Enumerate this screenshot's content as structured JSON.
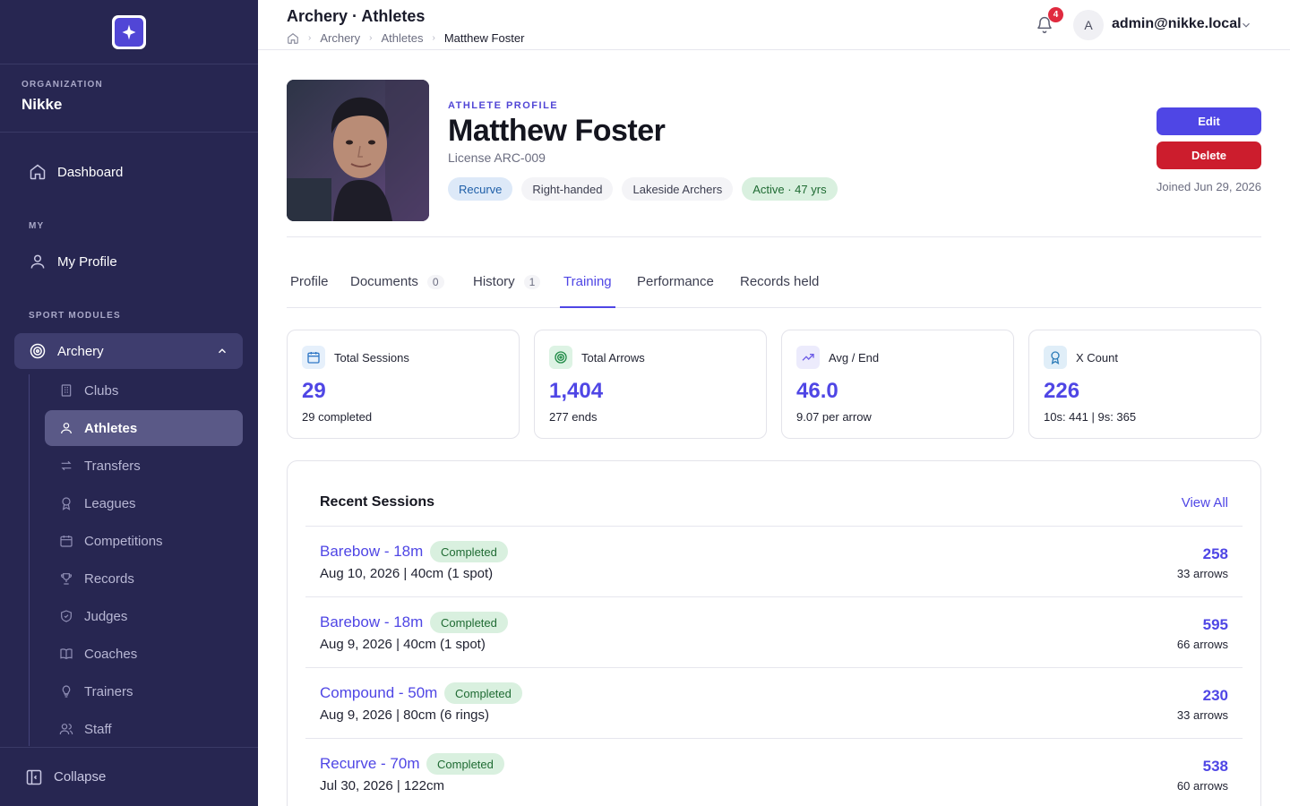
{
  "sidebar": {
    "org_label": "ORGANIZATION",
    "org_name": "Nikke",
    "dashboard": "Dashboard",
    "my_label": "MY",
    "my_profile": "My Profile",
    "modules_label": "SPORT MODULES",
    "module": "Archery",
    "sub_items": [
      {
        "label": "Clubs",
        "icon": "building-icon"
      },
      {
        "label": "Athletes",
        "icon": "user-icon"
      },
      {
        "label": "Transfers",
        "icon": "arrows-icon"
      },
      {
        "label": "Leagues",
        "icon": "award-icon"
      },
      {
        "label": "Competitions",
        "icon": "calendar-icon"
      },
      {
        "label": "Records",
        "icon": "trophy-icon"
      },
      {
        "label": "Judges",
        "icon": "shield-icon"
      },
      {
        "label": "Coaches",
        "icon": "book-icon"
      },
      {
        "label": "Trainers",
        "icon": "lightbulb-icon"
      },
      {
        "label": "Staff",
        "icon": "users-icon"
      }
    ],
    "active_item": "Athletes",
    "collapse": "Collapse"
  },
  "header": {
    "title": "Archery · Athletes",
    "breadcrumbs": [
      "Archery",
      "Athletes",
      "Matthew Foster"
    ],
    "notification_count": "4",
    "avatar_initial": "A",
    "user_email": "admin@nikke.local"
  },
  "profile": {
    "eyebrow": "ATHLETE PROFILE",
    "name": "Matthew Foster",
    "license": "License ARC-009",
    "tags": [
      "Recurve",
      "Right-handed",
      "Lakeside Archers",
      "Active · 47 yrs"
    ],
    "edit_label": "Edit",
    "delete_label": "Delete",
    "joined": "Joined Jun 29, 2026"
  },
  "tabs": [
    {
      "label": "Profile"
    },
    {
      "label": "Documents",
      "count": "0"
    },
    {
      "label": "History",
      "count": "1"
    },
    {
      "label": "Training"
    },
    {
      "label": "Performance"
    },
    {
      "label": "Records held"
    }
  ],
  "active_tab": "Training",
  "stats": [
    {
      "label": "Total Sessions",
      "value": "29",
      "sub": "29 completed",
      "icon": "calendar-icon"
    },
    {
      "label": "Total Arrows",
      "value": "1,404",
      "sub": "277 ends",
      "icon": "target-icon"
    },
    {
      "label": "Avg / End",
      "value": "46.0",
      "sub": "9.07 per arrow",
      "icon": "trending-up-icon"
    },
    {
      "label": "X Count",
      "value": "226",
      "sub": "10s: 441 | 9s: 365",
      "icon": "award-icon"
    }
  ],
  "recent_sessions": {
    "title": "Recent Sessions",
    "view_all": "View All",
    "rows": [
      {
        "name": "Barebow - 18m",
        "status": "Completed",
        "detail": "Aug 10, 2026 | 40cm (1 spot)",
        "score": "258",
        "arrows": "33 arrows"
      },
      {
        "name": "Barebow - 18m",
        "status": "Completed",
        "detail": "Aug 9, 2026 | 40cm (1 spot)",
        "score": "595",
        "arrows": "66 arrows"
      },
      {
        "name": "Compound - 50m",
        "status": "Completed",
        "detail": "Aug 9, 2026 | 80cm (6 rings)",
        "score": "230",
        "arrows": "33 arrows"
      },
      {
        "name": "Recurve - 70m",
        "status": "Completed",
        "detail": "Jul 30, 2026 | 122cm",
        "score": "538",
        "arrows": "60 arrows"
      }
    ]
  },
  "colors": {
    "sidebar_bg": "#272651",
    "accent": "#4f46e5",
    "danger": "#cc1d2d",
    "success_bg": "#d9f0df",
    "success_text": "#1f6b33"
  }
}
